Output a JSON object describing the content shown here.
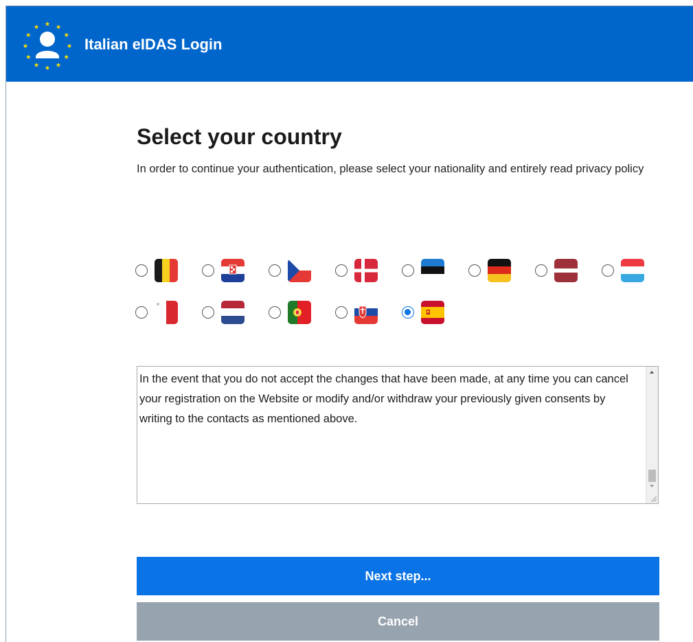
{
  "header": {
    "title": "Italian eIDAS Login",
    "logo_icon": "eu-stars-user-icon"
  },
  "main": {
    "title": "Select your country",
    "intro": "In order to continue your authentication, please select your nationality and entirely read privacy policy"
  },
  "countries": [
    {
      "code": "BE",
      "flag": "belgium-flag-icon",
      "selected": false
    },
    {
      "code": "HR",
      "flag": "croatia-flag-icon",
      "selected": false
    },
    {
      "code": "CZ",
      "flag": "czech-flag-icon",
      "selected": false
    },
    {
      "code": "DK",
      "flag": "denmark-flag-icon",
      "selected": false
    },
    {
      "code": "EE",
      "flag": "estonia-flag-icon",
      "selected": false
    },
    {
      "code": "DE",
      "flag": "germany-flag-icon",
      "selected": false
    },
    {
      "code": "LV",
      "flag": "latvia-flag-icon",
      "selected": false
    },
    {
      "code": "LU",
      "flag": "luxembourg-flag-icon",
      "selected": false
    },
    {
      "code": "MT",
      "flag": "malta-flag-icon",
      "selected": false
    },
    {
      "code": "NL",
      "flag": "netherlands-flag-icon",
      "selected": false
    },
    {
      "code": "PT",
      "flag": "portugal-flag-icon",
      "selected": false
    },
    {
      "code": "SK",
      "flag": "slovakia-flag-icon",
      "selected": false
    },
    {
      "code": "ES",
      "flag": "spain-flag-icon",
      "selected": true
    }
  ],
  "policy": {
    "text": "In the event that you do not accept the changes that have been made, at any time you can cancel your registration on the Website or modify and/or withdraw your previously given consents by writing to the contacts as mentioned above."
  },
  "buttons": {
    "next": "Next step...",
    "cancel": "Cancel"
  },
  "colors": {
    "header": "#0066cc",
    "primary_button": "#0a74e6",
    "cancel_button": "#97a3af",
    "eu_star": "#ffdd00"
  }
}
